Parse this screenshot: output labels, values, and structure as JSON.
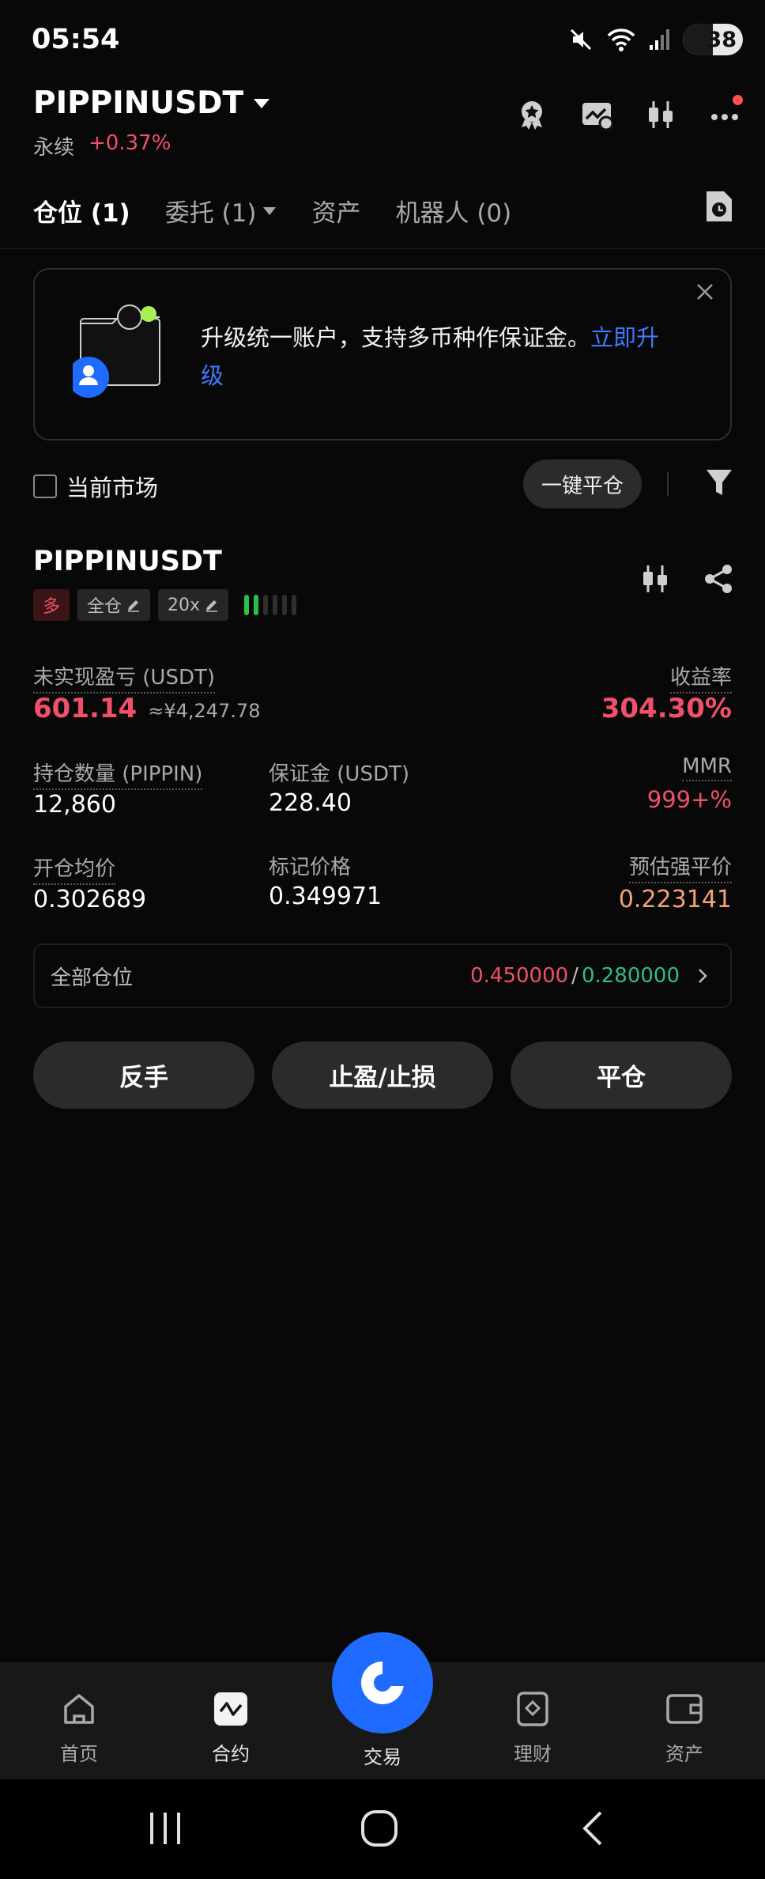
{
  "status_bar": {
    "time": "05:54",
    "battery": "38"
  },
  "header": {
    "pair": "PIPPINUSDT",
    "market_type": "永续",
    "change": "+0.37%"
  },
  "tabs": [
    {
      "label": "仓位 (1)"
    },
    {
      "label": "委托 (1)"
    },
    {
      "label": "资产"
    },
    {
      "label": "机器人 (0)"
    }
  ],
  "banner": {
    "text": "升级统一账户，支持多币种作保证金。",
    "link": "立即升级"
  },
  "filter": {
    "current_market": "当前市场",
    "close_all": "一键平仓"
  },
  "position": {
    "symbol": "PIPPINUSDT",
    "side": "多",
    "margin_mode": "全仓",
    "leverage": "20x",
    "risk_bars_on": 2,
    "unrealized_pnl_label": "未实现盈亏 (USDT)",
    "unrealized_pnl": "601.14",
    "unrealized_pnl_cny": "≈¥4,247.78",
    "roe_label": "收益率",
    "roe": "304.30%",
    "qty_label": "持仓数量 (PIPPIN)",
    "qty": "12,860",
    "margin_label": "保证金 (USDT)",
    "margin": "228.40",
    "mmr_label": "MMR",
    "mmr": "999+%",
    "entry_label": "开仓均价",
    "entry": "0.302689",
    "mark_label": "标记价格",
    "mark": "0.349971",
    "liq_label": "预估强平价",
    "liq": "0.223141",
    "all_positions_label": "全部仓位",
    "tp_price": "0.450000",
    "sl_price": "0.280000",
    "slash": "/"
  },
  "actions": {
    "reverse": "反手",
    "tpsl": "止盈/止损",
    "close": "平仓"
  },
  "bottom_nav": {
    "home": "首页",
    "futures": "合约",
    "trade": "交易",
    "earn": "理财",
    "assets": "资产"
  },
  "colors": {
    "accent_blue": "#1f6bff",
    "loss_red": "#f0506a",
    "profit_green": "#2ebd85",
    "liq_orange": "#f5a276"
  }
}
